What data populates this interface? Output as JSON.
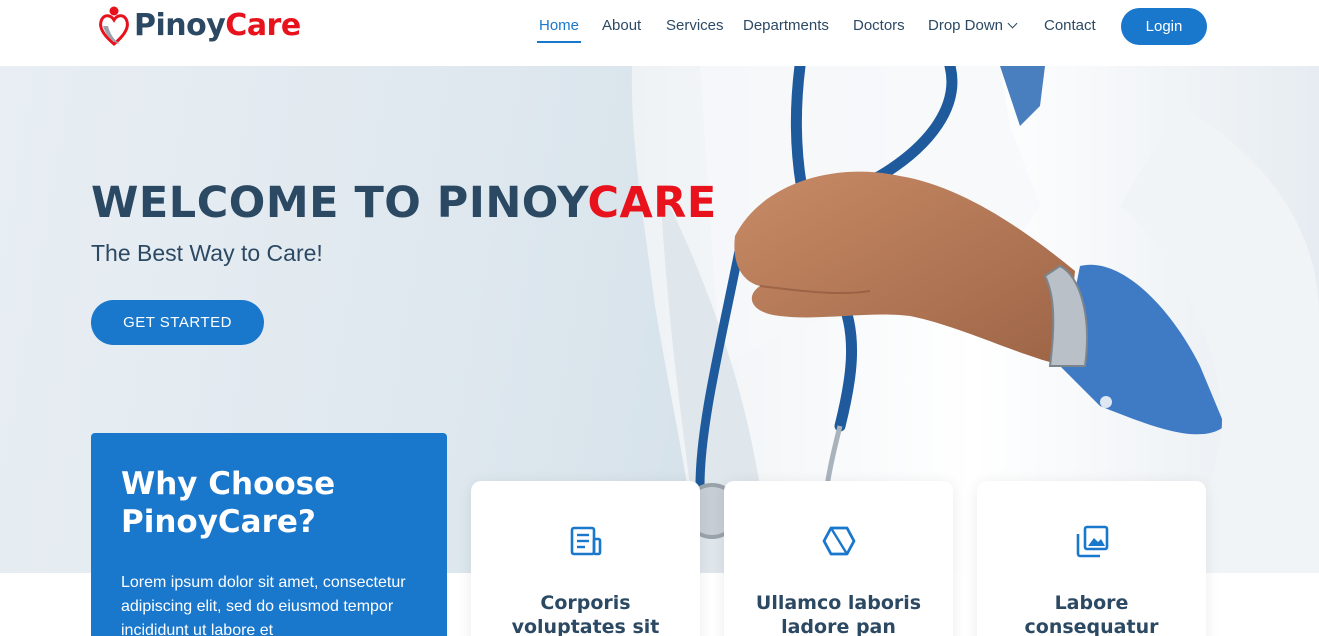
{
  "brand": {
    "name_part1": "Pinoy",
    "name_part2": "Care"
  },
  "nav": {
    "items": [
      {
        "label": "Home",
        "active": true
      },
      {
        "label": "About"
      },
      {
        "label": "Services"
      },
      {
        "label": "Departments"
      },
      {
        "label": "Doctors"
      },
      {
        "label": "Drop Down",
        "icon": "chevron-down-icon"
      },
      {
        "label": "Contact"
      }
    ],
    "login_label": "Login"
  },
  "hero": {
    "title_part1": "WELCOME TO PINOY",
    "title_part2": "CARE",
    "subtitle": "The Best Way to Care!",
    "cta_label": "GET STARTED"
  },
  "why": {
    "title": "Why Choose PinoyCare?",
    "text": "Lorem ipsum dolor sit amet, consectetur adipiscing elit, sed do eiusmod tempor incididunt ut labore et"
  },
  "cards": [
    {
      "icon": "document-icon",
      "title": "Corporis voluptates sit"
    },
    {
      "icon": "cube-icon",
      "title": "Ullamco laboris ladore pan"
    },
    {
      "icon": "images-icon",
      "title": "Labore consequatur"
    }
  ],
  "colors": {
    "primary": "#1977cc",
    "heading": "#2c4964",
    "accent_red": "#e8121c"
  }
}
